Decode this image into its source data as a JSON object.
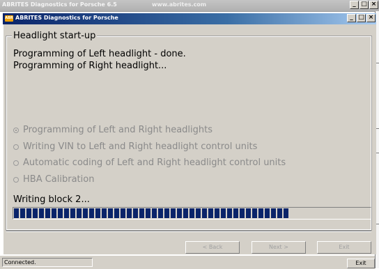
{
  "outer_window": {
    "title": "ABRITES Diagnostics for Porsche 6.5",
    "url": "www.abrites.com",
    "buttons": {
      "minimize": "_",
      "maximize": "□",
      "close": "×"
    }
  },
  "inner_window": {
    "icon_text": "ABR",
    "title": "ABRITES Diagnostics for Porsche",
    "buttons": {
      "minimize": "_",
      "maximize": "□",
      "close": "×"
    }
  },
  "group": {
    "title": "Headlight start-up",
    "status_lines": [
      "Programming of Left headlight - done.",
      "Programming of Right headlight..."
    ],
    "options": [
      {
        "label": "Programming of Left and Right headlights",
        "checked": true
      },
      {
        "label": "Writing VIN to Left and Right headlight  control units",
        "checked": false
      },
      {
        "label": "Automatic coding of Left and Right headlight  control units",
        "checked": false
      },
      {
        "label": "HBA Calibration",
        "checked": false
      }
    ]
  },
  "progress": {
    "label": "Writing block 2...",
    "fraction": 0.78,
    "color": "#0a246a"
  },
  "nav_buttons": {
    "back": "< Back",
    "next": "Next >",
    "exit": "Exit"
  },
  "statusbar": {
    "status": "Connected.",
    "exit": "Exit"
  }
}
